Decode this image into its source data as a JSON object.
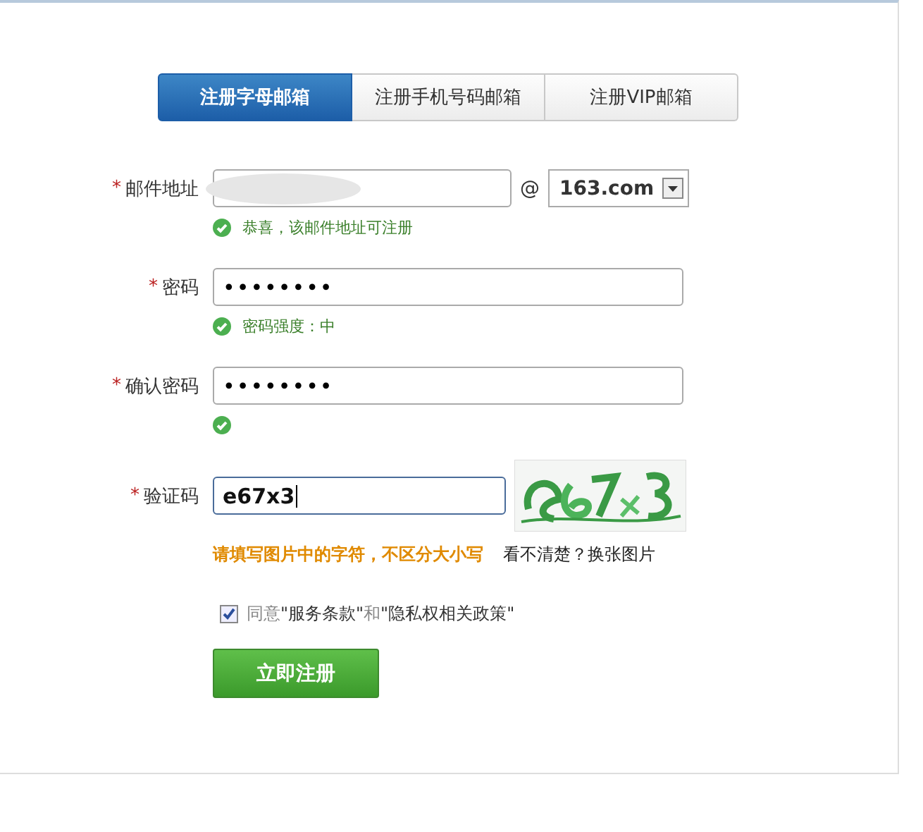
{
  "tabs": [
    {
      "label": "注册字母邮箱",
      "selected": true
    },
    {
      "label": "注册手机号码邮箱",
      "selected": false
    },
    {
      "label": "注册VIP邮箱",
      "selected": false
    }
  ],
  "form": {
    "email": {
      "label": "邮件地址",
      "required_mark": "*",
      "at": "@",
      "domain": "163.com",
      "status": {
        "valid": true,
        "message": "恭喜，该邮件地址可注册"
      }
    },
    "password": {
      "label": "密码",
      "required_mark": "*",
      "value": "••••••••",
      "status": {
        "valid": true,
        "message": "密码强度：中"
      }
    },
    "confirm": {
      "label": "确认密码",
      "required_mark": "*",
      "value": "••••••••",
      "status": {
        "valid": true
      }
    },
    "captcha": {
      "label": "验证码",
      "required_mark": "*",
      "value": "e67x3",
      "focused": true,
      "hint": "请填写图片中的字符，不区分大小写",
      "refresh_link": "看不清楚？换张图片"
    },
    "agreement": {
      "checked": true,
      "prefix": "同意",
      "terms": "\"服务条款\"",
      "joiner": "和",
      "privacy": "\"隐私权相关政策\""
    },
    "submit": "立即注册"
  }
}
